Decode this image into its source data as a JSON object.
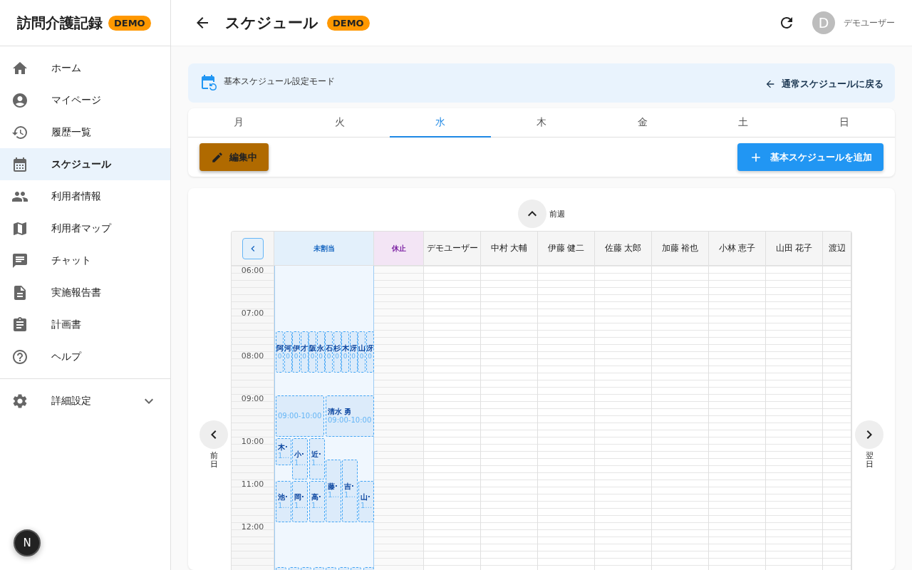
{
  "app": {
    "title": "訪問介護記録",
    "badge": "DEMO"
  },
  "nav": [
    {
      "label": "ホーム",
      "selected": false
    },
    {
      "label": "マイページ",
      "selected": false
    },
    {
      "label": "履歴一覧",
      "selected": false
    },
    {
      "label": "スケジュール",
      "selected": true
    },
    {
      "label": "利用者情報",
      "selected": false
    },
    {
      "label": "利用者マップ",
      "selected": false
    },
    {
      "label": "チャット",
      "selected": false
    },
    {
      "label": "実施報告書",
      "selected": false
    },
    {
      "label": "計画書",
      "selected": false
    },
    {
      "label": "ヘルプ",
      "selected": false
    }
  ],
  "settings": {
    "label": "詳細設定",
    "expanded": false
  },
  "corner_avatar": "N",
  "header": {
    "title": "スケジュール",
    "badge": "DEMO",
    "user_initial": "D",
    "user_name": "デモユーザー"
  },
  "banner": {
    "title": "基本スケジュール設定モード",
    "back_link": "通常スケジュールに戻る"
  },
  "day_tabs": [
    {
      "label": "月",
      "selected": false
    },
    {
      "label": "火",
      "selected": false
    },
    {
      "label": "水",
      "selected": true
    },
    {
      "label": "木",
      "selected": false
    },
    {
      "label": "金",
      "selected": false
    },
    {
      "label": "土",
      "selected": false
    },
    {
      "label": "日",
      "selected": false
    }
  ],
  "edit_button": "編集中",
  "add_button": "基本スケジュールを追加",
  "schedule": {
    "prev_week": "前週",
    "prev_day": "前日",
    "next_day": "翌日",
    "unassigned_header": "未割当",
    "pause_header": "休止",
    "staff": [
      "デモユーザー",
      "中村 大輔",
      "伊藤 健二",
      "佐藤 太郎",
      "加藤 裕也",
      "小林 恵子",
      "山田 花子",
      "渡辺"
    ],
    "hours": [
      "06:00",
      "07:00",
      "08:00",
      "09:00",
      "10:00",
      "11:00",
      "12:00"
    ],
    "unassigned_events": [
      {
        "name": "阿",
        "time": "0"
      },
      {
        "name": "河",
        "time": "0"
      },
      {
        "name": "伊",
        "time": "0"
      },
      {
        "name": "才",
        "time": "0"
      },
      {
        "name": "阪",
        "time": "0"
      },
      {
        "name": "永",
        "time": "0"
      },
      {
        "name": "石",
        "time": "0"
      },
      {
        "name": "杉",
        "time": "0"
      },
      {
        "name": "木",
        "time": "0"
      },
      {
        "name": "冴",
        "time": "0"
      },
      {
        "name": "山",
        "time": "0"
      },
      {
        "name": "冴",
        "time": "0"
      },
      {
        "time": "09:00-10:00"
      },
      {
        "name": "清水 勇",
        "time": "09:00-10:00"
      },
      {
        "name": "木·",
        "time": "1…"
      },
      {
        "name": "小·",
        "time": "1…"
      },
      {
        "name": "近·",
        "time": "1…"
      },
      {
        "name": "藤·",
        "time": "1…"
      },
      {
        "name": "吉·",
        "time": "1…"
      },
      {
        "name": "池·",
        "time": "1…"
      },
      {
        "name": "岡·",
        "time": "1…"
      },
      {
        "name": "高·",
        "time": "1…"
      },
      {
        "name": "山·",
        "time": "1…"
      }
    ]
  }
}
